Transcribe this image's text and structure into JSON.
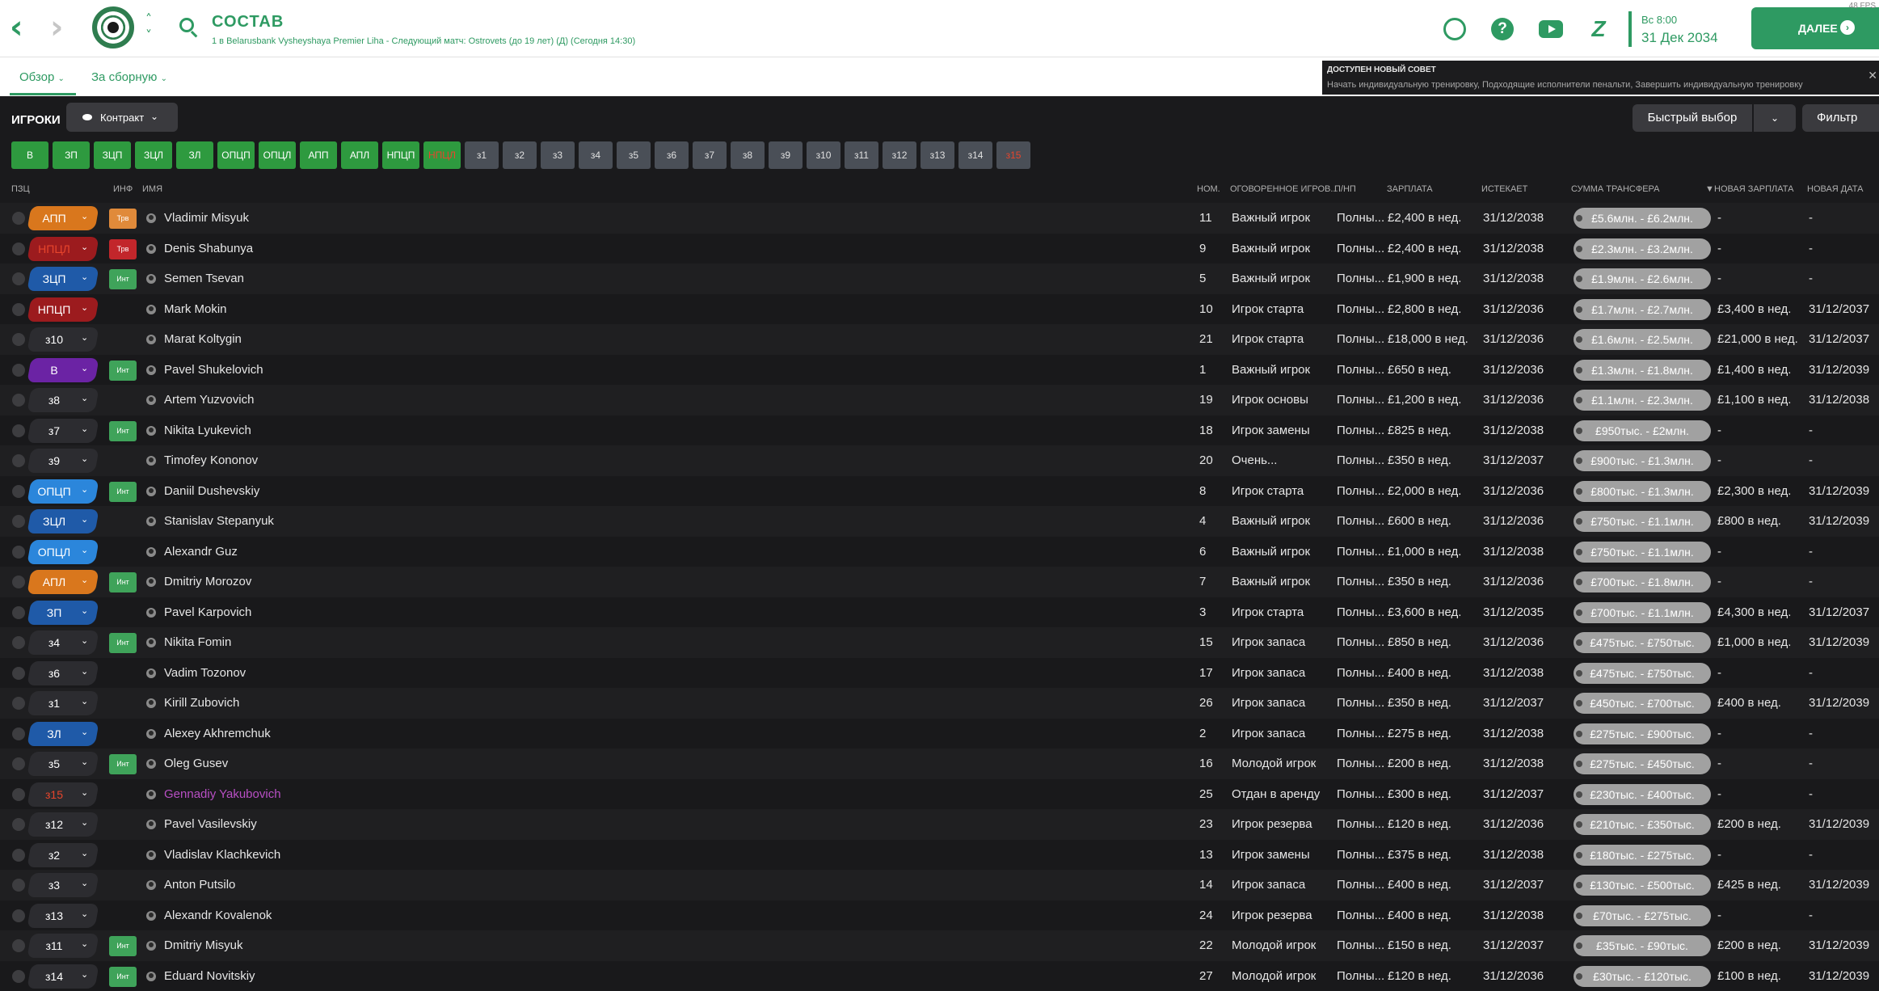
{
  "header": {
    "title": "СОСТАВ",
    "subtitle": "1 в Belarusbank Vysheyshaya Premier Liha - Следующий матч: Ostrovets (до 19 лет) (Д) (Сегодня 14:30)",
    "time_of_day": "Вс 8:00",
    "date": "31 Дек 2034",
    "next_label": "ДАЛЕЕ",
    "corner_label": "48 FPS"
  },
  "subnav": {
    "tab_overview": "Обзор",
    "tab_national": "За сборную"
  },
  "advice": {
    "title": "ДОСТУПЕН НОВЫЙ СОВЕТ",
    "body": "Начать индивидуальную тренировку, Подходящие исполнители пенальти, Завершить индивидуальную тренировку"
  },
  "players": {
    "title": "ИГРОКИ",
    "view": "Контракт",
    "quick_select": "Быстрый выбор",
    "filter": "Фильтр"
  },
  "position_filters": [
    {
      "label": "В",
      "kind": "pos"
    },
    {
      "label": "ЗП",
      "kind": "pos"
    },
    {
      "label": "ЗЦП",
      "kind": "pos"
    },
    {
      "label": "ЗЦЛ",
      "kind": "pos"
    },
    {
      "label": "ЗЛ",
      "kind": "pos"
    },
    {
      "label": "ОПЦП",
      "kind": "pos"
    },
    {
      "label": "ОПЦЛ",
      "kind": "pos"
    },
    {
      "label": "АПП",
      "kind": "pos"
    },
    {
      "label": "АПЛ",
      "kind": "pos"
    },
    {
      "label": "НПЦП",
      "kind": "pos"
    },
    {
      "label": "НПЦЛ",
      "kind": "pos-warn"
    },
    {
      "label": "з1",
      "kind": "sub"
    },
    {
      "label": "з2",
      "kind": "sub"
    },
    {
      "label": "з3",
      "kind": "sub"
    },
    {
      "label": "з4",
      "kind": "sub"
    },
    {
      "label": "з5",
      "kind": "sub"
    },
    {
      "label": "з6",
      "kind": "sub"
    },
    {
      "label": "з7",
      "kind": "sub"
    },
    {
      "label": "з8",
      "kind": "sub"
    },
    {
      "label": "з9",
      "kind": "sub"
    },
    {
      "label": "з10",
      "kind": "sub"
    },
    {
      "label": "з11",
      "kind": "sub"
    },
    {
      "label": "з12",
      "kind": "sub"
    },
    {
      "label": "з13",
      "kind": "sub"
    },
    {
      "label": "з14",
      "kind": "sub"
    },
    {
      "label": "з15",
      "kind": "sub-warn"
    }
  ],
  "columns": {
    "pos": "ПЗЦ",
    "info": "ИНФ",
    "name": "ИМЯ",
    "num": "НОМ.",
    "status": "ОГОВОРЕННОЕ ИГРОВ...",
    "ppnp": "П/НП",
    "wage": "ЗАРПЛАТА",
    "expires": "ИСТЕКАЕТ",
    "transfer": "СУММА ТРАНСФЕРА",
    "new_wage": "НОВАЯ ЗАРПЛАТА",
    "new_date": "НОВАЯ ДАТА"
  },
  "colors": {
    "accent": "#2e9a62",
    "orange": "#d9771d",
    "red": "#9c1b1e",
    "blue": "#1f5aa8",
    "light_blue": "#2b86db",
    "purple": "#6b23a4",
    "sub_chip": "#2c2c30",
    "badge_green": "#3fa35a",
    "badge_orange": "#e08a3a",
    "badge_red": "#c2262b"
  },
  "rows": [
    {
      "pos": "АПП",
      "pos_color": "#d9771d",
      "pos_text_color": "#ffffff",
      "badge": "Трв",
      "badge_color": "#e08a3a",
      "name": "Vladimir Misyuk",
      "num": "11",
      "status": "Важный игрок",
      "ppnp": "Полны...",
      "wage": "£2,400 в нед.",
      "expires": "31/12/2038",
      "transfer": "£5.6млн. - £6.2млн.",
      "new_wage": "-",
      "new_date": "-"
    },
    {
      "pos": "НПЦЛ",
      "pos_color": "#9c1b1e",
      "pos_text_color": "#e7452c",
      "badge": "Трв",
      "badge_color": "#c2262b",
      "name": "Denis Shabunya",
      "num": "9",
      "status": "Важный игрок",
      "ppnp": "Полны...",
      "wage": "£2,400 в нед.",
      "expires": "31/12/2038",
      "transfer": "£2.3млн. - £3.2млн.",
      "new_wage": "-",
      "new_date": "-"
    },
    {
      "pos": "ЗЦП",
      "pos_color": "#1f5aa8",
      "pos_text_color": "#ffffff",
      "badge": "Инт",
      "badge_color": "#3fa35a",
      "name": "Semen Tsevan",
      "num": "5",
      "status": "Важный игрок",
      "ppnp": "Полны...",
      "wage": "£1,900 в нед.",
      "expires": "31/12/2038",
      "transfer": "£1.9млн. - £2.6млн.",
      "new_wage": "-",
      "new_date": "-"
    },
    {
      "pos": "НПЦП",
      "pos_color": "#9c1b1e",
      "pos_text_color": "#ffffff",
      "badge": "",
      "badge_color": "",
      "name": "Mark Mokin",
      "num": "10",
      "status": "Игрок старта",
      "ppnp": "Полны...",
      "wage": "£2,800 в нед.",
      "expires": "31/12/2036",
      "transfer": "£1.7млн. - £2.7млн.",
      "new_wage": "£3,400 в нед.",
      "new_date": "31/12/2037"
    },
    {
      "pos": "з10",
      "pos_color": "#2c2c30",
      "pos_text_color": "#ffffff",
      "badge": "",
      "badge_color": "",
      "name": "Marat Koltygin",
      "num": "21",
      "status": "Игрок старта",
      "ppnp": "Полны...",
      "wage": "£18,000 в нед.",
      "expires": "31/12/2036",
      "transfer": "£1.6млн. - £2.5млн.",
      "new_wage": "£21,000 в нед.",
      "new_date": "31/12/2037"
    },
    {
      "pos": "В",
      "pos_color": "#6b23a4",
      "pos_text_color": "#ffffff",
      "badge": "Инт",
      "badge_color": "#3fa35a",
      "name": "Pavel Shukelovich",
      "num": "1",
      "status": "Важный игрок",
      "ppnp": "Полны...",
      "wage": "£650 в нед.",
      "expires": "31/12/2036",
      "transfer": "£1.3млн. - £1.8млн.",
      "new_wage": "£1,400 в нед.",
      "new_date": "31/12/2039"
    },
    {
      "pos": "з8",
      "pos_color": "#2c2c30",
      "pos_text_color": "#ffffff",
      "badge": "",
      "badge_color": "",
      "name": "Artem Yuzvovich",
      "num": "19",
      "status": "Игрок основы",
      "ppnp": "Полны...",
      "wage": "£1,200 в нед.",
      "expires": "31/12/2036",
      "transfer": "£1.1млн. - £2.3млн.",
      "new_wage": "£1,100 в нед.",
      "new_date": "31/12/2038"
    },
    {
      "pos": "з7",
      "pos_color": "#2c2c30",
      "pos_text_color": "#ffffff",
      "badge": "Инт",
      "badge_color": "#3fa35a",
      "name": "Nikita Lyukevich",
      "num": "18",
      "status": "Игрок замены",
      "ppnp": "Полны...",
      "wage": "£825 в нед.",
      "expires": "31/12/2038",
      "transfer": "£950тыс. - £2млн.",
      "new_wage": "-",
      "new_date": "-"
    },
    {
      "pos": "з9",
      "pos_color": "#2c2c30",
      "pos_text_color": "#ffffff",
      "badge": "",
      "badge_color": "",
      "name": "Timofey Kononov",
      "num": "20",
      "status": "Очень...",
      "ppnp": "Полны...",
      "wage": "£350 в нед.",
      "expires": "31/12/2037",
      "transfer": "£900тыс. - £1.3млн.",
      "new_wage": "-",
      "new_date": "-"
    },
    {
      "pos": "ОПЦП",
      "pos_color": "#2b86db",
      "pos_text_color": "#ffffff",
      "badge": "Инт",
      "badge_color": "#3fa35a",
      "name": "Daniil Dushevskiy",
      "num": "8",
      "status": "Игрок старта",
      "ppnp": "Полны...",
      "wage": "£2,000 в нед.",
      "expires": "31/12/2036",
      "transfer": "£800тыс. - £1.3млн.",
      "new_wage": "£2,300 в нед.",
      "new_date": "31/12/2039"
    },
    {
      "pos": "ЗЦЛ",
      "pos_color": "#1f5aa8",
      "pos_text_color": "#ffffff",
      "badge": "",
      "badge_color": "",
      "name": "Stanislav Stepanyuk",
      "num": "4",
      "status": "Важный игрок",
      "ppnp": "Полны...",
      "wage": "£600 в нед.",
      "expires": "31/12/2036",
      "transfer": "£750тыс. - £1.1млн.",
      "new_wage": "£800 в нед.",
      "new_date": "31/12/2039"
    },
    {
      "pos": "ОПЦЛ",
      "pos_color": "#2b86db",
      "pos_text_color": "#ffffff",
      "badge": "",
      "badge_color": "",
      "name": "Alexandr Guz",
      "num": "6",
      "status": "Важный игрок",
      "ppnp": "Полны...",
      "wage": "£1,000 в нед.",
      "expires": "31/12/2038",
      "transfer": "£750тыс. - £1.1млн.",
      "new_wage": "-",
      "new_date": "-"
    },
    {
      "pos": "АПЛ",
      "pos_color": "#d9771d",
      "pos_text_color": "#ffffff",
      "badge": "Инт",
      "badge_color": "#3fa35a",
      "name": "Dmitriy Morozov",
      "num": "7",
      "status": "Важный игрок",
      "ppnp": "Полны...",
      "wage": "£350 в нед.",
      "expires": "31/12/2036",
      "transfer": "£700тыс. - £1.8млн.",
      "new_wage": "-",
      "new_date": "-"
    },
    {
      "pos": "ЗП",
      "pos_color": "#1f5aa8",
      "pos_text_color": "#ffffff",
      "badge": "",
      "badge_color": "",
      "name": "Pavel Karpovich",
      "num": "3",
      "status": "Игрок старта",
      "ppnp": "Полны...",
      "wage": "£3,600 в нед.",
      "expires": "31/12/2035",
      "transfer": "£700тыс. - £1.1млн.",
      "new_wage": "£4,300 в нед.",
      "new_date": "31/12/2037"
    },
    {
      "pos": "з4",
      "pos_color": "#2c2c30",
      "pos_text_color": "#ffffff",
      "badge": "Инт",
      "badge_color": "#3fa35a",
      "name": "Nikita Fomin",
      "num": "15",
      "status": "Игрок запаса",
      "ppnp": "Полны...",
      "wage": "£850 в нед.",
      "expires": "31/12/2036",
      "transfer": "£475тыс. - £750тыс.",
      "new_wage": "£1,000 в нед.",
      "new_date": "31/12/2039"
    },
    {
      "pos": "з6",
      "pos_color": "#2c2c30",
      "pos_text_color": "#ffffff",
      "badge": "",
      "badge_color": "",
      "name": "Vadim Tozonov",
      "num": "17",
      "status": "Игрок запаса",
      "ppnp": "Полны...",
      "wage": "£400 в нед.",
      "expires": "31/12/2038",
      "transfer": "£475тыс. - £750тыс.",
      "new_wage": "-",
      "new_date": "-"
    },
    {
      "pos": "з1",
      "pos_color": "#2c2c30",
      "pos_text_color": "#ffffff",
      "badge": "",
      "badge_color": "",
      "name": "Kirill Zubovich",
      "num": "26",
      "status": "Игрок запаса",
      "ppnp": "Полны...",
      "wage": "£350 в нед.",
      "expires": "31/12/2037",
      "transfer": "£450тыс. - £700тыс.",
      "new_wage": "£400 в нед.",
      "new_date": "31/12/2039"
    },
    {
      "pos": "ЗЛ",
      "pos_color": "#1f5aa8",
      "pos_text_color": "#ffffff",
      "badge": "",
      "badge_color": "",
      "name": "Alexey Akhremchuk",
      "num": "2",
      "status": "Игрок запаса",
      "ppnp": "Полны...",
      "wage": "£275 в нед.",
      "expires": "31/12/2038",
      "transfer": "£275тыс. - £900тыс.",
      "new_wage": "-",
      "new_date": "-"
    },
    {
      "pos": "з5",
      "pos_color": "#2c2c30",
      "pos_text_color": "#ffffff",
      "badge": "Инт",
      "badge_color": "#3fa35a",
      "name": "Oleg Gusev",
      "num": "16",
      "status": "Молодой игрок",
      "ppnp": "Полны...",
      "wage": "£200 в нед.",
      "expires": "31/12/2038",
      "transfer": "£275тыс. - £450тыс.",
      "new_wage": "-",
      "new_date": "-"
    },
    {
      "pos": "з15",
      "pos_color": "#2c2c30",
      "pos_text_color": "#e7452c",
      "badge": "",
      "badge_color": "",
      "name": "Gennadiy Yakubovich",
      "name_color": "#b84fc4",
      "num": "25",
      "status": "Отдан в аренду",
      "ppnp": "Полны...",
      "wage": "£300 в нед.",
      "expires": "31/12/2037",
      "transfer": "£230тыс. - £400тыс.",
      "new_wage": "-",
      "new_date": "-"
    },
    {
      "pos": "з12",
      "pos_color": "#2c2c30",
      "pos_text_color": "#ffffff",
      "badge": "",
      "badge_color": "",
      "name": "Pavel Vasilevskiy",
      "num": "23",
      "status": "Игрок резерва",
      "ppnp": "Полны...",
      "wage": "£120 в нед.",
      "expires": "31/12/2036",
      "transfer": "£210тыс. - £350тыс.",
      "new_wage": "£200 в нед.",
      "new_date": "31/12/2039"
    },
    {
      "pos": "з2",
      "pos_color": "#2c2c30",
      "pos_text_color": "#ffffff",
      "badge": "",
      "badge_color": "",
      "name": "Vladislav Klachkevich",
      "num": "13",
      "status": "Игрок замены",
      "ppnp": "Полны...",
      "wage": "£375 в нед.",
      "expires": "31/12/2038",
      "transfer": "£180тыс. - £275тыс.",
      "new_wage": "-",
      "new_date": "-"
    },
    {
      "pos": "з3",
      "pos_color": "#2c2c30",
      "pos_text_color": "#ffffff",
      "badge": "",
      "badge_color": "",
      "name": "Anton Putsilo",
      "num": "14",
      "status": "Игрок запаса",
      "ppnp": "Полны...",
      "wage": "£400 в нед.",
      "expires": "31/12/2037",
      "transfer": "£130тыс. - £500тыс.",
      "new_wage": "£425 в нед.",
      "new_date": "31/12/2039"
    },
    {
      "pos": "з13",
      "pos_color": "#2c2c30",
      "pos_text_color": "#ffffff",
      "badge": "",
      "badge_color": "",
      "name": "Alexandr Kovalenok",
      "num": "24",
      "status": "Игрок резерва",
      "ppnp": "Полны...",
      "wage": "£400 в нед.",
      "expires": "31/12/2038",
      "transfer": "£70тыс. - £275тыс.",
      "new_wage": "-",
      "new_date": "-"
    },
    {
      "pos": "з11",
      "pos_color": "#2c2c30",
      "pos_text_color": "#ffffff",
      "badge": "Инт",
      "badge_color": "#3fa35a",
      "name": "Dmitriy Misyuk",
      "num": "22",
      "status": "Молодой игрок",
      "ppnp": "Полны...",
      "wage": "£150 в нед.",
      "expires": "31/12/2037",
      "transfer": "£35тыс. - £90тыс.",
      "new_wage": "£200 в нед.",
      "new_date": "31/12/2039"
    },
    {
      "pos": "з14",
      "pos_color": "#2c2c30",
      "pos_text_color": "#ffffff",
      "badge": "Инт",
      "badge_color": "#3fa35a",
      "name": "Eduard Novitskiy",
      "num": "27",
      "status": "Молодой игрок",
      "ppnp": "Полны...",
      "wage": "£120 в нед.",
      "expires": "31/12/2036",
      "transfer": "£30тыс. - £120тыс.",
      "new_wage": "£100 в нед.",
      "new_date": "31/12/2039"
    }
  ]
}
